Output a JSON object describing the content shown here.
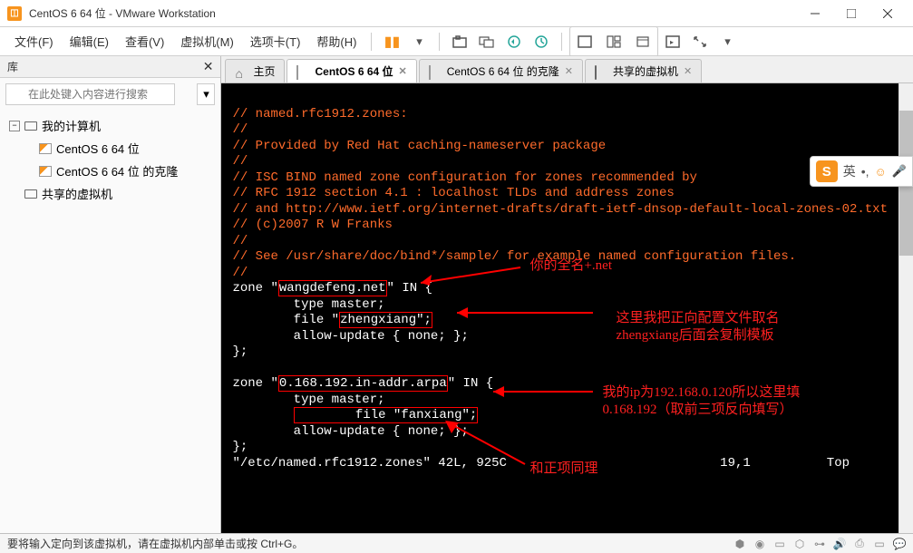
{
  "titlebar": {
    "title": "CentOS 6 64 位 - VMware Workstation"
  },
  "menu": {
    "file": "文件(F)",
    "edit": "编辑(E)",
    "view": "查看(V)",
    "vm": "虚拟机(M)",
    "tabs": "选项卡(T)",
    "help": "帮助(H)"
  },
  "sidebar": {
    "title": "库",
    "search_placeholder": "在此处键入内容进行搜索",
    "root": "我的计算机",
    "items": [
      "CentOS 6 64 位",
      "CentOS 6 64 位 的克隆"
    ],
    "shared": "共享的虚拟机"
  },
  "tabs": {
    "home": "主页",
    "vm1": "CentOS 6 64 位",
    "vm2": "CentOS 6 64 位 的克隆",
    "shared": "共享的虚拟机"
  },
  "terminal": {
    "l1": "// named.rfc1912.zones:",
    "l2": "//",
    "l3": "// Provided by Red Hat caching-nameserver package",
    "l4": "//",
    "l5": "// ISC BIND named zone configuration for zones recommended by",
    "l6": "// RFC 1912 section 4.1 : localhost TLDs and address zones",
    "l7": "// and http://www.ietf.org/internet-drafts/draft-ietf-dnsop-default-local-zones-02.txt",
    "l8": "// (c)2007 R W Franks",
    "l9": "//",
    "l10": "// See /usr/share/doc/bind*/sample/ for example named configuration files.",
    "l11": "//",
    "z1a": "zone \"",
    "z1b": "wangdefeng.net",
    "z1c": "\" IN {",
    "z1d": "        type master;",
    "z1e": "        file \"",
    "z1f": "zhengxiang\";",
    "z1g": "        allow-update { none; };",
    "z1h": "};",
    "z2a": "zone \"",
    "z2b": "0.168.192.in-addr.arpa",
    "z2c": "\" IN {",
    "z2d": "        type master;",
    "z2e": "        file \"fanxiang\";",
    "z2f": "        allow-update { none; };",
    "z2g": "};",
    "status_a": "\"/etc/named.rfc1912.zones\" 42L, 925C",
    "status_b": "19,1",
    "status_c": "Top"
  },
  "annotations": {
    "a1": "你的全名+.net",
    "a2a": "这里我把正向配置文件取名",
    "a2b": "zhengxiang后面会复制模板",
    "a3a": "我的ip为192.168.0.120所以这里填",
    "a3b": "0.168.192（取前三项反向填写）",
    "a4": "和正项同理"
  },
  "statusbar": {
    "text": "要将输入定向到该虚拟机，请在虚拟机内部单击或按 Ctrl+G。"
  },
  "ime": {
    "lang": "英"
  }
}
